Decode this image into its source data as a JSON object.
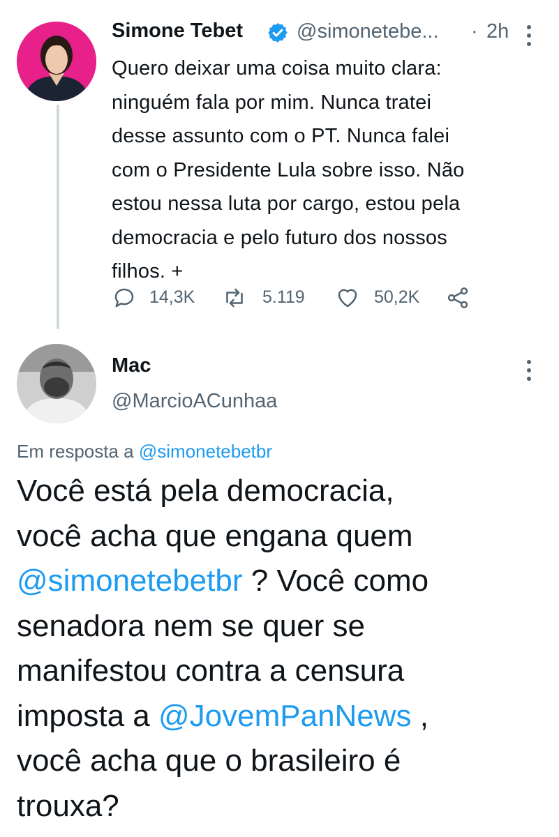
{
  "parent_tweet": {
    "name": "Simone Tebet",
    "handle": "@simonetebe...",
    "separator": "·",
    "time": "2h",
    "text_lines": [
      "Quero deixar uma coisa muito clara:",
      "ninguém fala por mim. Nunca tratei",
      "desse assunto com o PT. Nunca falei",
      "com o Presidente Lula sobre isso. Não",
      "estou nessa luta por cargo, estou pela",
      "democracia e pelo futuro dos nossos",
      "filhos. +"
    ],
    "actions": {
      "replies": "14,3K",
      "retweets": "5.119",
      "likes": "50,2K"
    }
  },
  "reply_tweet": {
    "name": "Mac",
    "handle": "@MarcioACunhaa",
    "reply_to_prefix": "Em resposta a",
    "reply_to_handle": "@simonetebetbr",
    "text": {
      "line1": "Você está pela democracia,",
      "line2": "você acha que engana quem",
      "line3_mention": "@simonetebetbr",
      "line3_rest": " ? Você como",
      "line4": "senadora nem se quer se",
      "line5": "manifestou contra a censura",
      "line6_prefix": "imposta a ",
      "line6_mention": "@JovemPanNews",
      "line6_rest": " ,",
      "line7": "você acha que o brasileiro é",
      "line8": "trouxa?"
    }
  },
  "colors": {
    "accent": "#1d9bf0",
    "secondary_text": "#536471",
    "thread_line": "#cfd9de"
  },
  "icons": [
    "verified-badge-icon",
    "more-options-icon",
    "reply-icon",
    "retweet-icon",
    "like-icon",
    "share-icon"
  ]
}
